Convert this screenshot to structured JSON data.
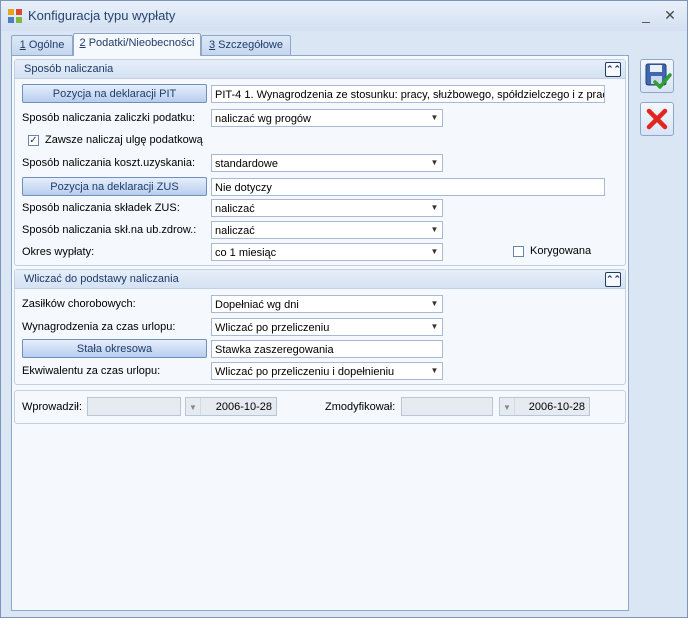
{
  "window": {
    "title": "Konfiguracja typu wypłaty",
    "minimize_glyph": "_",
    "close_glyph": "✕"
  },
  "tabs": [
    {
      "key": "1",
      "label": " Ogólne"
    },
    {
      "key": "2",
      "label": " Podatki/Nieobecności"
    },
    {
      "key": "3",
      "label": " Szczegółowe"
    }
  ],
  "section1": {
    "title": "Sposób naliczania",
    "pit_button": "Pozycja na deklaracji PIT",
    "pit_value": "PIT-4 1. Wynagrodzenia ze stosunku: pracy, służbowego, spółdzielczego i z prac",
    "tax_advance_label": "Sposób naliczania zaliczki podatku:",
    "tax_advance_value": "naliczać wg progów",
    "always_relief_label": "Zawsze naliczaj ulgę podatkową",
    "always_relief_checked": true,
    "costs_label": "Sposób naliczania koszt.uzyskania:",
    "costs_value": "standardowe",
    "zus_button": "Pozycja na deklaracji ZUS",
    "zus_value": "Nie dotyczy",
    "zus_contrib_label": "Sposób naliczania składek ZUS:",
    "zus_contrib_value": "naliczać",
    "health_label": "Sposób naliczania skł.na ub.zdrow.:",
    "health_value": "naliczać",
    "period_label": "Okres wypłaty:",
    "period_value": "co 1 miesiąc",
    "corrected_label": "Korygowana",
    "corrected_checked": false
  },
  "section2": {
    "title": "Wliczać do podstawy naliczania",
    "sick_label": "Zasiłków chorobowych:",
    "sick_value": "Dopełniać wg dni",
    "vacation_label": "Wynagrodzenia za czas urlopu:",
    "vacation_value": "Wliczać po przeliczeniu",
    "fixed_button": "Stała okresowa",
    "fixed_value": "Stawka zaszeregowania",
    "equivalent_label": "Ekwiwalentu za czas urlopu:",
    "equivalent_value": "Wliczać po przeliczeniu i dopełnieniu"
  },
  "footer": {
    "entered_label": "Wprowadził:",
    "entered_user": "",
    "entered_date": "2006-10-28",
    "modified_label": "Zmodyfikował:",
    "modified_user": "",
    "modified_date": "2006-10-28"
  },
  "icons": {
    "arrow_down": "▼",
    "collapse": "⌃⌃",
    "check": "✓"
  },
  "colors": {
    "accent": "#1d3a66",
    "save_green": "#2fa02f",
    "cancel_red": "#e0261f"
  }
}
